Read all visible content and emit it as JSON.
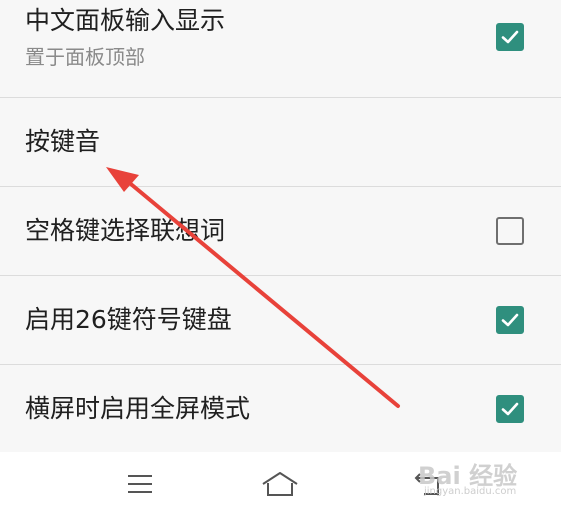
{
  "settings": [
    {
      "title": "中文面板输入显示",
      "subtitle": "置于面板顶部",
      "checked": true,
      "has_checkbox": true
    },
    {
      "title": "按键音",
      "has_checkbox": false
    },
    {
      "title": "空格键选择联想词",
      "checked": false,
      "has_checkbox": true
    },
    {
      "title": "启用26键符号键盘",
      "checked": true,
      "has_checkbox": true
    },
    {
      "title": "横屏时启用全屏模式",
      "checked": true,
      "has_checkbox": true
    }
  ],
  "nav": {
    "menu_icon": "menu-icon",
    "home_icon": "home-icon",
    "back_icon": "back-icon"
  },
  "watermark": {
    "text": "Bai 经验",
    "url": "jingyan.baidu.com"
  },
  "colors": {
    "checkbox_on": "#2f8f7e",
    "checkbox_off_border": "#6f6f6f",
    "annotation_arrow": "#e8423a",
    "background": "#f7f7f7",
    "divider": "#dcdcdc"
  }
}
